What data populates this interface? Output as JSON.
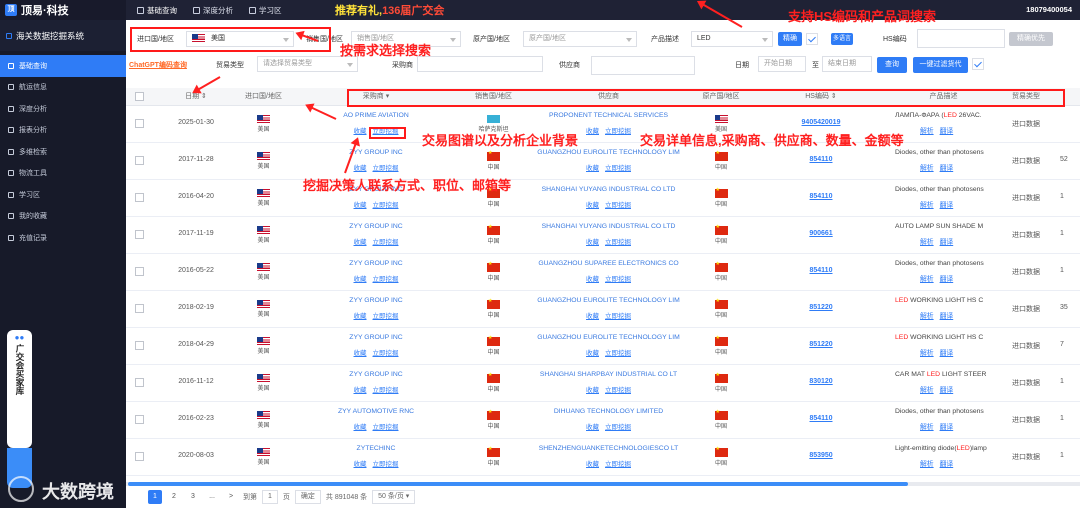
{
  "top": {
    "logo": "顶易·科技",
    "nav": [
      {
        "label": "基础查询",
        "active": true
      },
      {
        "label": "深度分析",
        "active": false
      },
      {
        "label": "学习区",
        "active": false
      }
    ],
    "promo_main": "推荐有礼,",
    "promo_red": "136届广交会",
    "phone": "18079400054"
  },
  "sidebar": {
    "system_name": "海关数据挖掘系统",
    "items": [
      "基础查询",
      "航运信息",
      "深度分析",
      "报表分析",
      "多维检索",
      "物流工具",
      "学习区",
      "我的收藏",
      "充值记录"
    ],
    "fair_text": "广交会买家库"
  },
  "filters": {
    "import_country_label": "进口国/地区",
    "import_country_value": "美国",
    "sales_country_label": "销售国/地区",
    "sales_country_placeholder": "销售国/地区",
    "origin_country_label": "原产国/地区",
    "origin_country_placeholder": "原产国/地区",
    "product_desc_label": "产品描述",
    "product_desc_value": "LED",
    "exact_label": "精确",
    "multi_lang_label": "多语言",
    "hs_label": "HS编码",
    "hs_exact_label": "精确优先",
    "chatgpt_link": "ChatGPT编码查询",
    "trade_type_label": "贸易类型",
    "trade_type_placeholder": "请选择贸易类型",
    "buyer_label": "采购商",
    "supplier_label": "供应商",
    "date_label": "日期",
    "start_date_placeholder": "开始日期",
    "to_label": "至",
    "end_date_placeholder": "结束日期",
    "query_button": "查询",
    "filter_button": "一键过滤货代"
  },
  "annotations": {
    "hs_search": "支持HS编码和产品词搜索",
    "on_demand": "按需求选择搜索",
    "trade_map": "交易图谱以及分析企业背景",
    "trade_detail": "交易详单信息,采购商、供应商、数量、金额等",
    "decision_maker": "挖掘决策人联系方式、职位、邮箱等"
  },
  "table": {
    "headers": [
      "日期",
      "进口国/地区",
      "采购商",
      "销售国/地区",
      "供应商",
      "原产国/地区",
      "HS编码",
      "产品描述",
      "贸易类型"
    ],
    "actions": {
      "favorite": "收藏",
      "mine": "立即挖掘",
      "analyze": "解析",
      "translate": "翻译"
    },
    "rows": [
      {
        "date": "2025-01-30",
        "import_country": "美国",
        "buyer": "AO PRIME AVIATION",
        "sales_flag": "kz",
        "sales_country": "哈萨克斯坦",
        "supplier": "PROPONENT TECHNICAL SERVICES",
        "origin_flag": "us",
        "origin_country": "美国",
        "hs": "9405420019",
        "desc_pre": "ЛАМПА-ФАРА (",
        "desc_led": "LED",
        "desc_post": " 26VAC.",
        "trade_type": "进口数据",
        "extra": ""
      },
      {
        "date": "2017-11-28",
        "import_country": "美国",
        "buyer": "ZYY GROUP INC",
        "sales_flag": "cn",
        "sales_country": "中国",
        "supplier": "GUANGZHOU EUROLITE TECHNOLOGY LIM",
        "origin_flag": "cn",
        "origin_country": "中国",
        "hs": "854110",
        "desc_pre": "Diodes, other than photosens",
        "desc_led": "",
        "desc_post": "",
        "trade_type": "进口数据",
        "extra": "52"
      },
      {
        "date": "2016-04-20",
        "import_country": "美国",
        "buyer": "ZYY GROUP INC",
        "sales_flag": "cn",
        "sales_country": "中国",
        "supplier": "SHANGHAI YUYANG INDUSTRIAL CO LTD",
        "origin_flag": "cn",
        "origin_country": "中国",
        "hs": "854110",
        "desc_pre": "Diodes, other than photosens",
        "desc_led": "",
        "desc_post": "",
        "trade_type": "进口数据",
        "extra": "1"
      },
      {
        "date": "2017-11-19",
        "import_country": "美国",
        "buyer": "ZYY GROUP INC",
        "sales_flag": "cn",
        "sales_country": "中国",
        "supplier": "SHANGHAI YUYANG INDUSTRIAL CO LTD",
        "origin_flag": "cn",
        "origin_country": "中国",
        "hs": "900661",
        "desc_pre": "AUTO LAMP SUN SHADE M",
        "desc_led": "",
        "desc_post": "",
        "trade_type": "进口数据",
        "extra": "1"
      },
      {
        "date": "2016-05-22",
        "import_country": "美国",
        "buyer": "ZYY GROUP INC",
        "sales_flag": "cn",
        "sales_country": "中国",
        "supplier": "GUANGZHOU SUPAREE ELECTRONICS CO",
        "origin_flag": "cn",
        "origin_country": "中国",
        "hs": "854110",
        "desc_pre": "Diodes, other than photosens",
        "desc_led": "",
        "desc_post": "",
        "trade_type": "进口数据",
        "extra": "1"
      },
      {
        "date": "2018-02-19",
        "import_country": "美国",
        "buyer": "ZYY GROUP INC",
        "sales_flag": "cn",
        "sales_country": "中国",
        "supplier": "GUANGZHOU EUROLITE TECHNOLOGY LIM",
        "origin_flag": "cn",
        "origin_country": "中国",
        "hs": "851220",
        "desc_pre": "",
        "desc_led": "LED",
        "desc_post": " WORKING LIGHT HS C",
        "trade_type": "进口数据",
        "extra": "35"
      },
      {
        "date": "2018-04-29",
        "import_country": "美国",
        "buyer": "ZYY GROUP INC",
        "sales_flag": "cn",
        "sales_country": "中国",
        "supplier": "GUANGZHOU EUROLITE TECHNOLOGY LIM",
        "origin_flag": "cn",
        "origin_country": "中国",
        "hs": "851220",
        "desc_pre": "",
        "desc_led": "LED",
        "desc_post": " WORKING LIGHT HS C",
        "trade_type": "进口数据",
        "extra": "7"
      },
      {
        "date": "2016-11-12",
        "import_country": "美国",
        "buyer": "ZYY GROUP INC",
        "sales_flag": "cn",
        "sales_country": "中国",
        "supplier": "SHANGHAI SHARPBAY INDUSTRIAL CO LT",
        "origin_flag": "cn",
        "origin_country": "中国",
        "hs": "830120",
        "desc_pre": "CAR MAT ",
        "desc_led": "LED",
        "desc_post": " LIGHT STEER",
        "trade_type": "进口数据",
        "extra": "1"
      },
      {
        "date": "2016-02-23",
        "import_country": "美国",
        "buyer": "ZYY AUTOMOTIVE RNC",
        "sales_flag": "cn",
        "sales_country": "中国",
        "supplier": "DIHUANG TECHNOLOGY LIMITED",
        "origin_flag": "cn",
        "origin_country": "中国",
        "hs": "854110",
        "desc_pre": "Diodes, other than photosens",
        "desc_led": "",
        "desc_post": "",
        "trade_type": "进口数据",
        "extra": "1"
      },
      {
        "date": "2020-08-03",
        "import_country": "美国",
        "buyer": "ZYTECHINC",
        "sales_flag": "cn",
        "sales_country": "中国",
        "supplier": "SHENZHENGUANKETECHNOLOGIESCO LT",
        "origin_flag": "cn",
        "origin_country": "中国",
        "hs": "853950",
        "desc_pre": "Light-emitting diode(",
        "desc_led": "LED",
        "desc_post": ")lamp",
        "trade_type": "进口数据",
        "extra": "1"
      }
    ]
  },
  "pager": {
    "pages": [
      "1",
      "2",
      "3",
      "...",
      ">"
    ],
    "goto_label": "到第",
    "goto_value": "1",
    "page_unit": "页",
    "confirm": "确定",
    "total": "共 891048 条",
    "page_size": "50 条/页"
  },
  "watermark": "大数跨境"
}
